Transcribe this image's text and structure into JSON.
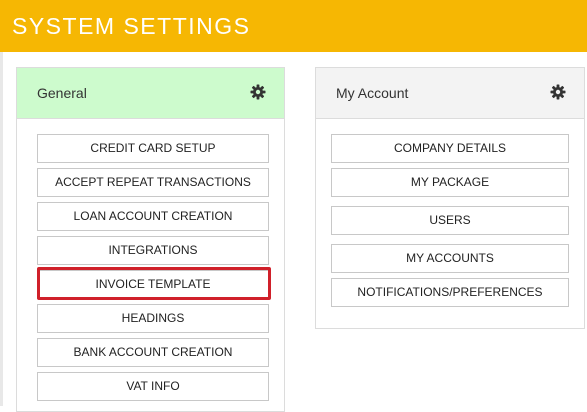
{
  "header": {
    "title": "SYSTEM SETTINGS"
  },
  "general": {
    "title": "General",
    "items": [
      "CREDIT CARD SETUP",
      "ACCEPT REPEAT TRANSACTIONS",
      "LOAN ACCOUNT CREATION",
      "INTEGRATIONS",
      "INVOICE TEMPLATE",
      "HEADINGS",
      "BANK ACCOUNT CREATION",
      "VAT INFO"
    ],
    "highlighted_item": "INVOICE TEMPLATE"
  },
  "account": {
    "title": "My Account",
    "items": [
      "COMPANY DETAILS",
      "MY PACKAGE",
      "USERS",
      "MY ACCOUNTS",
      "NOTIFICATIONS/PREFERENCES"
    ]
  },
  "colors": {
    "header_bg": "#f6b703",
    "general_header_bg": "#cdfbcd",
    "account_header_bg": "#f3f3f3",
    "highlight": "#d0202a"
  },
  "icons": {
    "panel_settings": "gear-icon"
  }
}
